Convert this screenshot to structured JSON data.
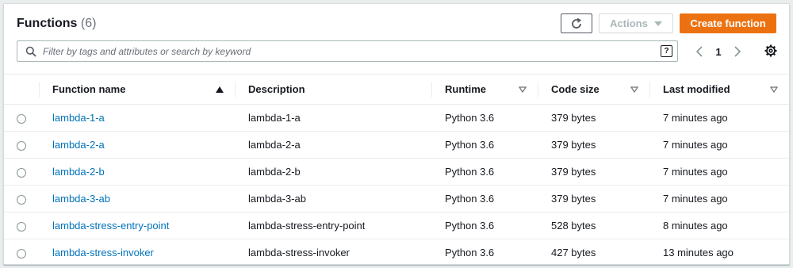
{
  "header": {
    "title": "Functions",
    "count": "(6)",
    "actions_label": "Actions",
    "create_label": "Create function"
  },
  "search": {
    "placeholder": "Filter by tags and attributes or search by keyword",
    "help": "?"
  },
  "pagination": {
    "current_page": "1"
  },
  "table": {
    "columns": {
      "name": "Function name",
      "description": "Description",
      "runtime": "Runtime",
      "code_size": "Code size",
      "last_modified": "Last modified"
    },
    "rows": [
      {
        "name": "lambda-1-a",
        "description": "lambda-1-a",
        "runtime": "Python 3.6",
        "code_size": "379 bytes",
        "last_modified": "7 minutes ago"
      },
      {
        "name": "lambda-2-a",
        "description": "lambda-2-a",
        "runtime": "Python 3.6",
        "code_size": "379 bytes",
        "last_modified": "7 minutes ago"
      },
      {
        "name": "lambda-2-b",
        "description": "lambda-2-b",
        "runtime": "Python 3.6",
        "code_size": "379 bytes",
        "last_modified": "7 minutes ago"
      },
      {
        "name": "lambda-3-ab",
        "description": "lambda-3-ab",
        "runtime": "Python 3.6",
        "code_size": "379 bytes",
        "last_modified": "7 minutes ago"
      },
      {
        "name": "lambda-stress-entry-point",
        "description": "lambda-stress-entry-point",
        "runtime": "Python 3.6",
        "code_size": "528 bytes",
        "last_modified": "8 minutes ago"
      },
      {
        "name": "lambda-stress-invoker",
        "description": "lambda-stress-invoker",
        "runtime": "Python 3.6",
        "code_size": "427 bytes",
        "last_modified": "13 minutes ago"
      }
    ]
  },
  "colors": {
    "primary_button": "#ec7211",
    "link": "#0073bb",
    "border": "#eaeded"
  },
  "icons": {
    "refresh": "refresh-icon",
    "actions_caret": "caret-down-icon",
    "search": "search-icon",
    "help": "help-icon",
    "prev_page": "chevron-left-icon",
    "next_page": "chevron-right-icon",
    "settings": "gear-icon",
    "sort_ascending": "sort-ascending-icon",
    "sort_filter": "sort-caret-icon"
  }
}
